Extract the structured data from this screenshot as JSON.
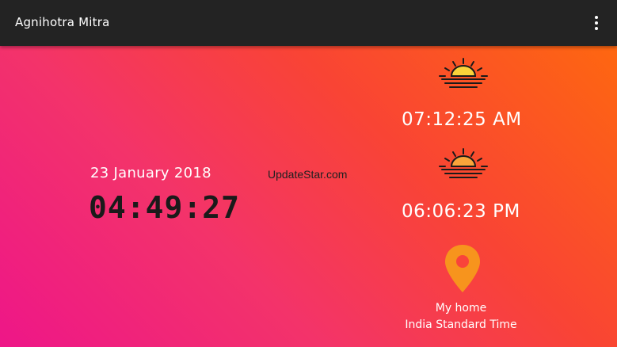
{
  "app_bar": {
    "title": "Agnihotra Mitra",
    "overflow_icon": "more-vert-icon",
    "background": "#232323"
  },
  "main": {
    "gradient_colors": [
      "#fe6710",
      "#f94434",
      "#f3336a",
      "#ee1688"
    ],
    "date": "23 January 2018",
    "current_time": "04:49:27",
    "watermark": "UpdateStar.com",
    "sunrise": {
      "icon": "sunrise-icon",
      "time": "07:12:25 AM"
    },
    "sunset": {
      "icon": "sunset-icon",
      "time": "06:06:23 PM"
    },
    "location": {
      "icon": "location-pin-icon",
      "pin_color": "#f7941d",
      "name": "My home",
      "timezone": "India Standard Time"
    }
  }
}
